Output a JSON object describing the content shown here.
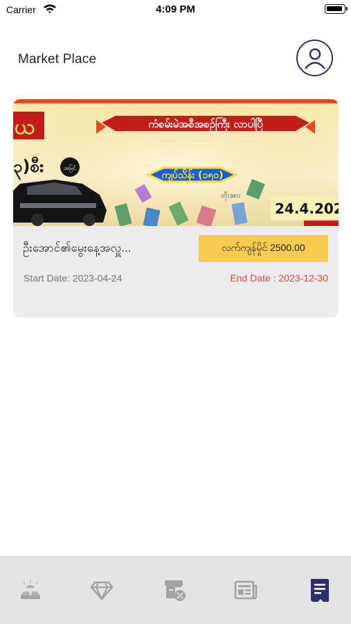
{
  "status_bar": {
    "carrier": "Carrier",
    "time": "4:09 PM"
  },
  "header": {
    "title": "Market Place",
    "profile_icon": "user-circle-icon"
  },
  "listing": {
    "banner": {
      "headline": "ကံစမ်းမဲအစီအစဉ်ကြီး လာပါပြီ",
      "prize_label": "ကျပ်သိန်း (၁၅၀)",
      "prize_suffix": "တိုးအား",
      "date_text": "24.4.202",
      "left_text": "ယ",
      "left_text_2": "၃)စီး",
      "tag": "အမြင်"
    },
    "title": "ဦးအောင်၏မွေးနေ့အလှူ...",
    "price_label": "လက်ကျန်မှိုင် 2500.00",
    "start_date": "Start Date: 2023-04-24",
    "end_date": "End Date : 2023-12-30"
  },
  "tab_bar": {
    "tabs": [
      {
        "icon": "gold-bars-icon",
        "active": false
      },
      {
        "icon": "diamond-icon",
        "active": false
      },
      {
        "icon": "discount-box-icon",
        "active": false
      },
      {
        "icon": "news-icon",
        "active": false
      },
      {
        "icon": "lottery-ticket-icon",
        "active": true
      }
    ]
  },
  "colors": {
    "accent": "#2d2f6d",
    "price_button": "#f5cc4f",
    "end_date": "#e8453c",
    "inactive_icon": "#a3a3a3"
  }
}
